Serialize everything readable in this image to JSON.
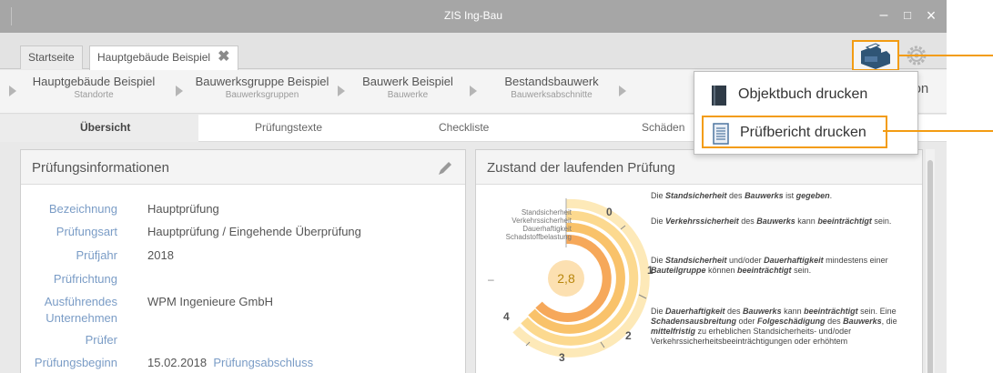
{
  "window": {
    "title": "ZIS Ing-Bau",
    "minimize": "–",
    "maximize": "□",
    "close": "×"
  },
  "tabs": [
    {
      "label": "Startseite"
    },
    {
      "label": "Hauptgebäude Beispiel",
      "close": "✖"
    }
  ],
  "breadcrumbs": [
    {
      "main": "Hauptgebäude Beispiel",
      "sub": "Standorte"
    },
    {
      "main": "Bauwerksgruppe Beispiel",
      "sub": "Bauwerksgruppen"
    },
    {
      "main": "Bauwerk Beispiel",
      "sub": "Bauwerke"
    },
    {
      "main": "Bestandsbauwerk",
      "sub": "Bauwerksabschnitte"
    },
    {
      "main": "ation",
      "sub": ""
    }
  ],
  "subtabs": [
    "Übersicht",
    "Prüfungstexte",
    "Checkliste",
    "Schäden"
  ],
  "info_panel": {
    "title": "Prüfungsinformationen",
    "rows": [
      {
        "label": "Bezeichnung",
        "value": "Hauptprüfung"
      },
      {
        "label": "Prüfungsart",
        "value": "Hauptprüfung / Eingehende Überprüfung"
      },
      {
        "label": "Prüfjahr",
        "value": "2018"
      },
      {
        "label": "Prüfrichtung",
        "value": ""
      },
      {
        "label": "Ausführendes",
        "label2": "Unternehmen",
        "value": "WPM Ingenieure GmbH"
      },
      {
        "label": "Prüfer",
        "value": ""
      },
      {
        "label": "Prüfungsbeginn",
        "value": "15.02.2018",
        "link": "Prüfungsabschluss"
      }
    ]
  },
  "status_panel": {
    "title": "Zustand der laufenden Prüfung",
    "score": "2,8",
    "legend": [
      "Standsicherheit",
      "Verkehrssicherheit",
      "Dauerhaftigkeit",
      "Schadstoffbelastung"
    ],
    "scale": [
      "0",
      "1",
      "2",
      "3",
      "4"
    ],
    "dash": "–",
    "descriptions": [
      {
        "html": "Die <b>Standsicherheit</b> des <b>Bauwerks</b> ist <b>gegeben</b>."
      },
      {
        "html": "Die <b>Verkehrssicherheit</b> des <b>Bauwerks</b> kann <b>beeinträchtigt</b> sein."
      },
      {
        "html": "Die <b>Standsicherheit</b> und/oder <b>Dauerhaftigkeit</b> mindestens einer <b>Bauteilgruppe</b> können <b>beeinträchtigt</b> sein."
      },
      {
        "html": "Die <b>Dauerhaftigkeit</b> des <b>Bauwerks</b> kann <b>beeinträchtigt</b> sein. Eine <b>Schadensausbreitung</b> oder <b>Folgeschädigung</b> des <b>Bauwerks</b>, die <b>mittelfristig</b> zu erheblichen Standsicherheits- und/oder Verkehrssicherheitsbeeinträchtigungen oder erhöhtem"
      }
    ]
  },
  "menu": {
    "items": [
      {
        "label": "Objektbuch drucken"
      },
      {
        "label": "Prüfbericht drucken"
      }
    ]
  },
  "colors": {
    "accent": "#f39c12",
    "link": "#7a9cc6",
    "ring_dark": "#f6b26b",
    "ring_mid": "#f9cb7f",
    "ring_light": "#fde9b8"
  }
}
